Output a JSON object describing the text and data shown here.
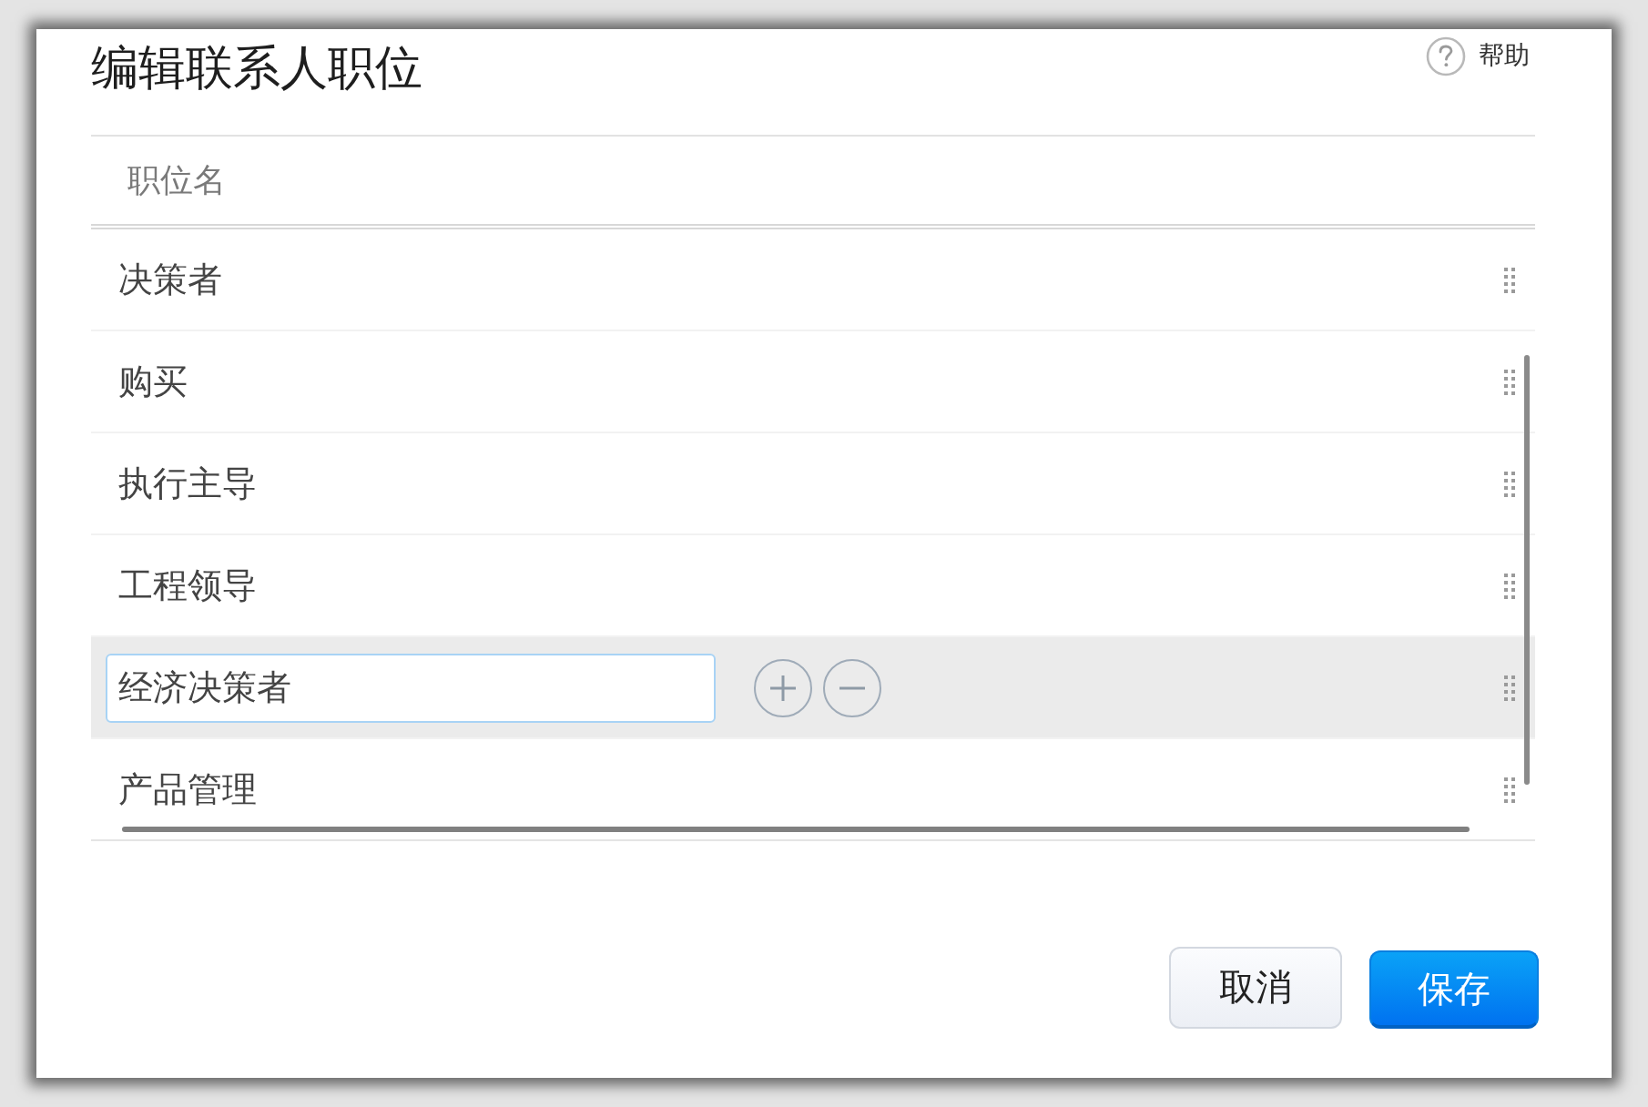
{
  "dialog": {
    "title": "编辑联系人职位",
    "help_label": "帮助"
  },
  "table": {
    "column": "职位名",
    "rows": [
      {
        "name": "决策者",
        "selected": false,
        "editing": false
      },
      {
        "name": "购买",
        "selected": false,
        "editing": false
      },
      {
        "name": "执行主导",
        "selected": false,
        "editing": false
      },
      {
        "name": "工程领导",
        "selected": false,
        "editing": false
      },
      {
        "name": "经济决策者",
        "selected": true,
        "editing": true
      },
      {
        "name": "产品管理",
        "selected": false,
        "editing": false
      }
    ]
  },
  "buttons": [
    {
      "label": "取消",
      "kind": "secondary"
    },
    {
      "label": "保存",
      "kind": "primary"
    }
  ]
}
